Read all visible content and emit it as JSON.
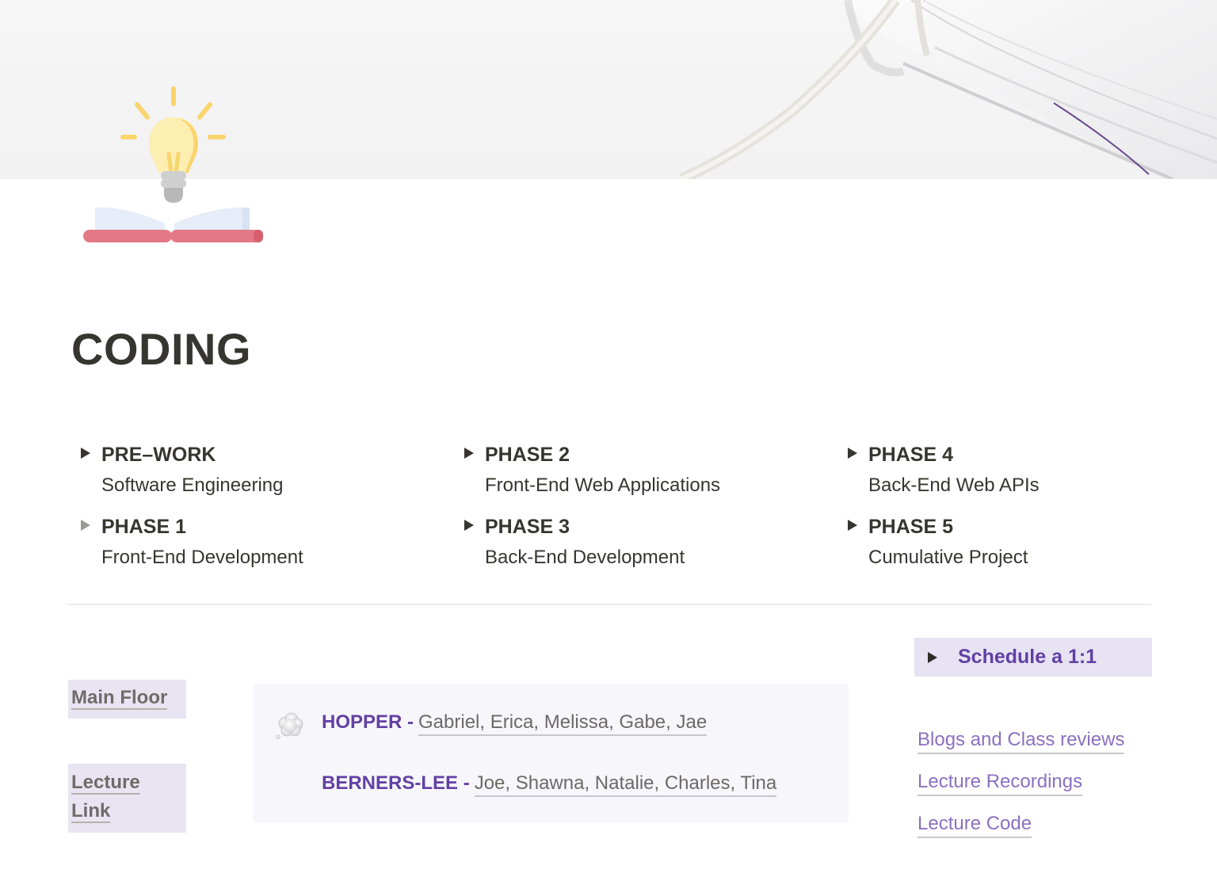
{
  "page": {
    "title": "CODING",
    "cover_image": "open-book-with-ribbon-bookmark",
    "icon": "lightbulb-over-open-book-icon"
  },
  "phases": [
    {
      "heading": "PRE–WORK",
      "subtitle": "Software Engineering",
      "collapsed": true
    },
    {
      "heading": "PHASE 1",
      "subtitle": "Front-End Development",
      "collapsed": true,
      "dimmed": true
    },
    {
      "heading": "PHASE 2",
      "subtitle": "Front-End Web Applications",
      "collapsed": true
    },
    {
      "heading": "PHASE 3",
      "subtitle": "Back-End Development",
      "collapsed": true
    },
    {
      "heading": "PHASE 4",
      "subtitle": "Back-End Web APIs",
      "collapsed": true
    },
    {
      "heading": "PHASE 5",
      "subtitle": "Cumulative Project",
      "collapsed": true
    }
  ],
  "left_links": {
    "main_floor": "Main Floor",
    "lecture_link_line1": "Lecture",
    "lecture_link_line2": "Link"
  },
  "groups_callout": {
    "icon": "thought-balloon-icon",
    "groups": [
      {
        "name": "HOPPER -",
        "members": "Gabriel, Erica, Melissa, Gabe, Jae"
      },
      {
        "name": "BERNERS-LEE -",
        "members": "Joe, Shawna, Natalie, Charles, Tina"
      }
    ]
  },
  "schedule_toggle": {
    "label": "Schedule a 1:1"
  },
  "resource_links": [
    {
      "label": "Blogs and Class reviews"
    },
    {
      "label": "Lecture Recordings"
    },
    {
      "label": "Lecture Code"
    }
  ],
  "colors": {
    "accent_purple": "#6240a4",
    "link_purple": "#8b70c0",
    "highlight_bg": "#e7e3f3",
    "callout_bg": "#f7f6fb",
    "text": "#37352f"
  }
}
